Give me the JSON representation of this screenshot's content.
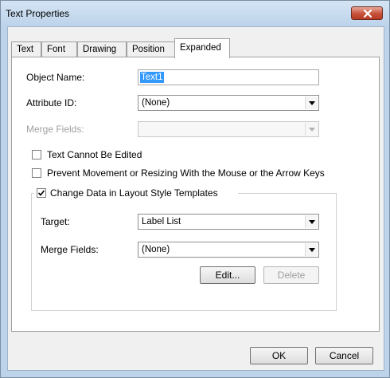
{
  "window": {
    "title": "Text Properties",
    "close_icon": "close-icon"
  },
  "tabs": [
    {
      "label": "Text"
    },
    {
      "label": "Font"
    },
    {
      "label": "Drawing"
    },
    {
      "label": "Position"
    },
    {
      "label": "Expanded",
      "active": true
    }
  ],
  "fields": {
    "object_name": {
      "label": "Object Name:",
      "value": "Text1"
    },
    "attribute_id": {
      "label": "Attribute ID:",
      "value": "(None)"
    },
    "merge_fields": {
      "label": "Merge Fields:",
      "value": "",
      "disabled": true
    }
  },
  "checkboxes": {
    "text_cannot_be_edited": {
      "label": "Text Cannot Be Edited",
      "checked": false
    },
    "prevent_movement": {
      "label": "Prevent Movement or Resizing With the Mouse or the Arrow Keys",
      "checked": false
    }
  },
  "group": {
    "label": "Change Data in Layout Style Templates",
    "checked": true,
    "target": {
      "label": "Target:",
      "value": "Label List"
    },
    "merge_fields": {
      "label": "Merge Fields:",
      "value": "(None)"
    },
    "edit_button": "Edit...",
    "delete_button": "Delete"
  },
  "buttons": {
    "ok": "OK",
    "cancel": "Cancel"
  },
  "colors": {
    "selection": "#3399ff",
    "close_button": "#c7513a",
    "title_bar": "#bcd3ea"
  }
}
